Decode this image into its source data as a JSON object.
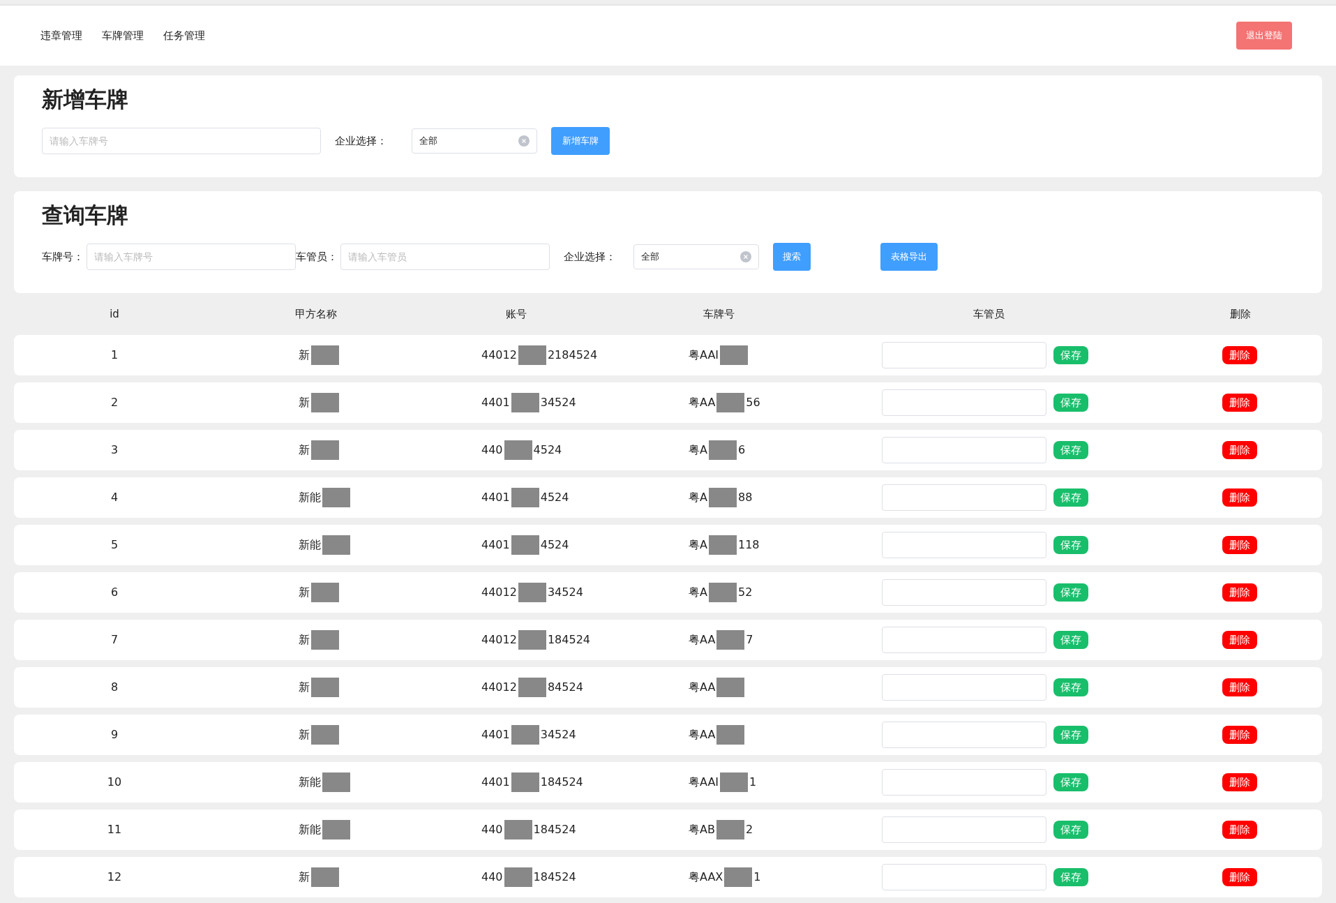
{
  "nav": {
    "items": [
      "违章管理",
      "车牌管理",
      "任务管理"
    ],
    "logout": "退出登陆"
  },
  "add_card": {
    "title": "新增车牌",
    "plate_field": {
      "placeholder": "请输入车牌号"
    },
    "company_label": "企业选择：",
    "company_select": {
      "value": "全部"
    },
    "add_button": "新增车牌"
  },
  "search_card": {
    "title": "查询车牌",
    "plate_label": "车牌号：",
    "plate_field": {
      "placeholder": "请输入车牌号"
    },
    "manager_label": "车管员：",
    "manager_field": {
      "placeholder": "请输入车管员"
    },
    "company_label": "企业选择：",
    "company_select": {
      "value": "全部"
    },
    "search_button": "搜索",
    "export_button": "表格导出"
  },
  "table": {
    "columns": [
      "id",
      "甲方名称",
      "账号",
      "车牌号",
      "车管员",
      "删除"
    ],
    "rows": [
      {
        "id": "1",
        "name": [
          "新"
        ],
        "account": [
          "44012",
          "2184524"
        ],
        "plate": [
          "粤AAI"
        ],
        "save": "保存",
        "delete": "删除"
      },
      {
        "id": "2",
        "name": [
          "新"
        ],
        "account": [
          "4401",
          "34524"
        ],
        "plate": [
          "粤AA",
          "56"
        ],
        "save": "保存",
        "delete": "删除"
      },
      {
        "id": "3",
        "name": [
          "新"
        ],
        "account": [
          "440",
          "4524"
        ],
        "plate": [
          "粤A",
          "6"
        ],
        "save": "保存",
        "delete": "删除"
      },
      {
        "id": "4",
        "name": [
          "新能"
        ],
        "account": [
          "4401",
          "4524"
        ],
        "plate": [
          "粤A",
          "88"
        ],
        "save": "保存",
        "delete": "删除"
      },
      {
        "id": "5",
        "name": [
          "新能"
        ],
        "account": [
          "4401",
          "4524"
        ],
        "plate": [
          "粤A",
          "118"
        ],
        "save": "保存",
        "delete": "删除"
      },
      {
        "id": "6",
        "name": [
          "新"
        ],
        "account": [
          "44012",
          "34524"
        ],
        "plate": [
          "粤A",
          "52"
        ],
        "save": "保存",
        "delete": "删除"
      },
      {
        "id": "7",
        "name": [
          "新"
        ],
        "account": [
          "44012",
          "184524"
        ],
        "plate": [
          "粤AA",
          "7"
        ],
        "save": "保存",
        "delete": "删除"
      },
      {
        "id": "8",
        "name": [
          "新"
        ],
        "account": [
          "44012",
          "84524"
        ],
        "plate": [
          "粤AA"
        ],
        "save": "保存",
        "delete": "删除"
      },
      {
        "id": "9",
        "name": [
          "新"
        ],
        "account": [
          "4401",
          "34524"
        ],
        "plate": [
          "粤AA"
        ],
        "save": "保存",
        "delete": "删除"
      },
      {
        "id": "10",
        "name": [
          "新能"
        ],
        "account": [
          "4401",
          "184524"
        ],
        "plate": [
          "粤AAI",
          "1"
        ],
        "save": "保存",
        "delete": "删除"
      },
      {
        "id": "11",
        "name": [
          "新能"
        ],
        "account": [
          "440",
          "184524"
        ],
        "plate": [
          "粤AB",
          "2"
        ],
        "save": "保存",
        "delete": "删除"
      },
      {
        "id": "12",
        "name": [
          "新"
        ],
        "account": [
          "440",
          "184524"
        ],
        "plate": [
          "粤AAX",
          "1"
        ],
        "save": "保存",
        "delete": "删除"
      }
    ]
  }
}
